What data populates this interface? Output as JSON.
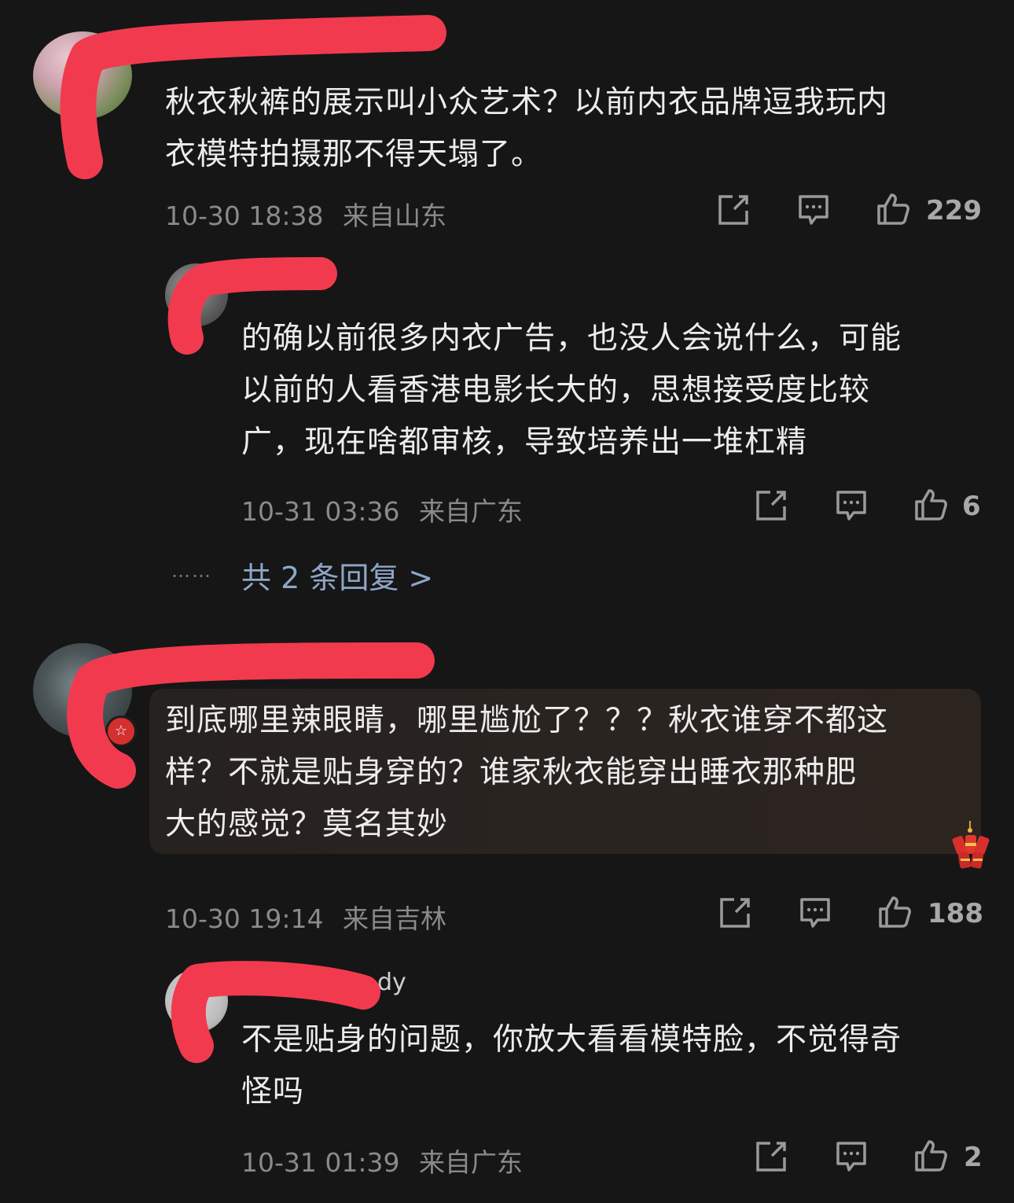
{
  "colors": {
    "background": "#161616",
    "text": "#ececec",
    "meta": "#8a8a8a",
    "link": "#8fa6c9",
    "redaction": "#f23a4f"
  },
  "comments": [
    {
      "username_visible": "",
      "text": "秋衣秋裤的展示叫小众艺术？以前内衣品牌逗我玩内衣模特拍摄那不得天塌了。",
      "line1": "秋衣秋裤的展示叫小众艺术？以前内衣品牌逗我玩内",
      "line2": "衣模特拍摄那不得天塌了。",
      "time": "10-30 18:38",
      "location": "来自山东",
      "likes": "229",
      "reply": {
        "username_visible": "",
        "line1": "的确以前很多内衣广告，也没人会说什么，可能",
        "line2": "以前的人看香港电影长大的，思想接受度比较",
        "line3": "广，现在啥都审核，导致培养出一堆杠精",
        "time": "10-31 03:36",
        "location": "来自广东",
        "likes": "6"
      },
      "more_replies_ellipsis": "……",
      "more_replies": "共 2 条回复 >"
    },
    {
      "username_visible": "",
      "line1": "到底哪里辣眼睛，哪里尴尬了？？？秋衣谁穿不都这",
      "line2": "样？不就是贴身穿的？谁家秋衣能穿出睡衣那种肥",
      "line3": "大的感觉？莫名其妙",
      "time": "10-30 19:14",
      "location": "来自吉林",
      "likes": "188",
      "reply": {
        "username_visible": "dy",
        "line1": "不是贴身的问题，你放大看看模特脸，不觉得奇",
        "line2": "怪吗",
        "time": "10-31 01:39",
        "location": "来自广东",
        "likes": "2"
      }
    }
  ],
  "icons": {
    "share": "share-icon",
    "comment": "comment-icon",
    "like": "thumbs-up-icon",
    "badge": "star-badge-icon",
    "decoration": "firecracker-icon"
  }
}
